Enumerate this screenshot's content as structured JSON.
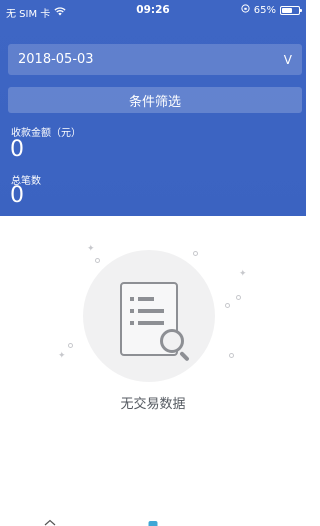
{
  "statusbar": {
    "carrier": "无 SIM 卡",
    "time": "09:26",
    "battery_text": "65%",
    "battery_level": 0.65
  },
  "filter": {
    "date_value": "2018-05-03",
    "date_chevron": "V",
    "button_label": "条件筛选"
  },
  "stats": {
    "amount_label": "收款金额（元）",
    "amount_value": "0",
    "count_label": "总笔数",
    "count_value": "0"
  },
  "empty_state": {
    "message": "无交易数据",
    "illustration_icon": "document-search-icon"
  },
  "tabbar": {
    "icons": [
      "home-icon",
      "wallet-icon",
      "profile-icon"
    ]
  },
  "colors": {
    "header_blue": "#3e66c4",
    "illustration_gray": "#8d8f94",
    "text_gray": "#555a61"
  }
}
